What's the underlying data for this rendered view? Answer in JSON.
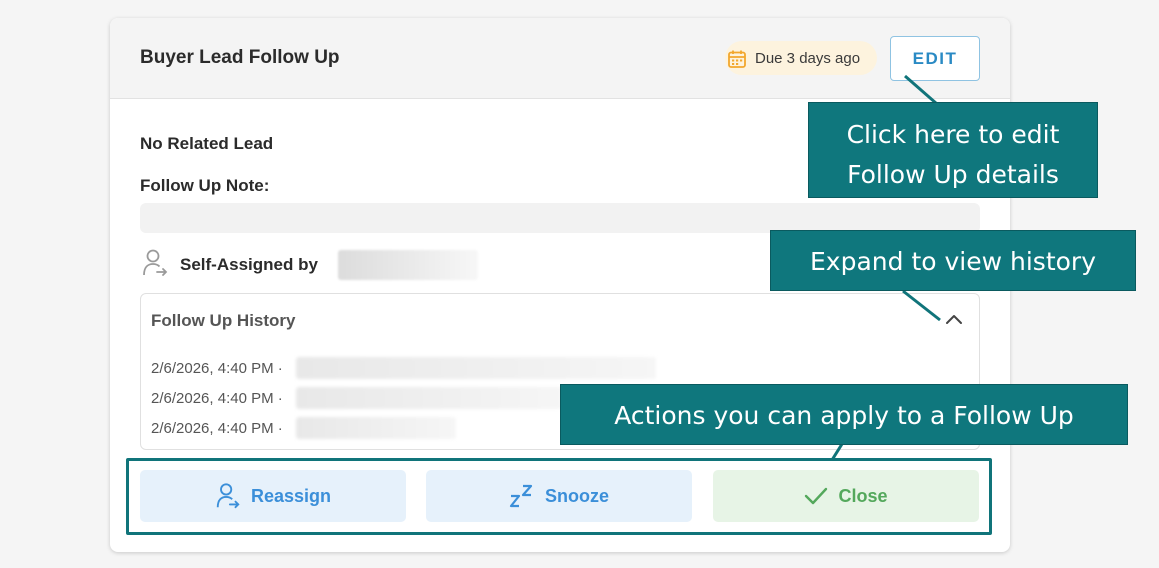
{
  "card": {
    "title": "Buyer Lead Follow Up",
    "due_badge": "Due 3 days ago",
    "edit_label": "EDIT",
    "related_lead": "No Related Lead",
    "note_label": "Follow Up Note:",
    "assigned_label": "Self-Assigned by",
    "history": {
      "title": "Follow Up History",
      "rows": [
        {
          "timestamp": "2/6/2026, 4:40 PM ·"
        },
        {
          "timestamp": "2/6/2026, 4:40 PM ·"
        },
        {
          "timestamp": "2/6/2026, 4:40 PM ·"
        }
      ]
    },
    "actions": {
      "reassign": "Reassign",
      "snooze": "Snooze",
      "close": "Close"
    }
  },
  "callouts": {
    "edit_line1": "Click here to edit",
    "edit_line2": "Follow Up details",
    "history": "Expand to view history",
    "actions": "Actions you can apply to a Follow Up"
  },
  "icons": {
    "due": "calendar-icon",
    "assign": "user-arrow-icon",
    "chevron": "chevron-up-icon",
    "reassign": "user-arrow-icon",
    "snooze": "zz-icon",
    "close": "check-icon"
  },
  "colors": {
    "accent": "#2a8ac4",
    "callout": "#0f777d",
    "due_badge_bg": "#fdf3de",
    "close_green": "#54a85c"
  }
}
